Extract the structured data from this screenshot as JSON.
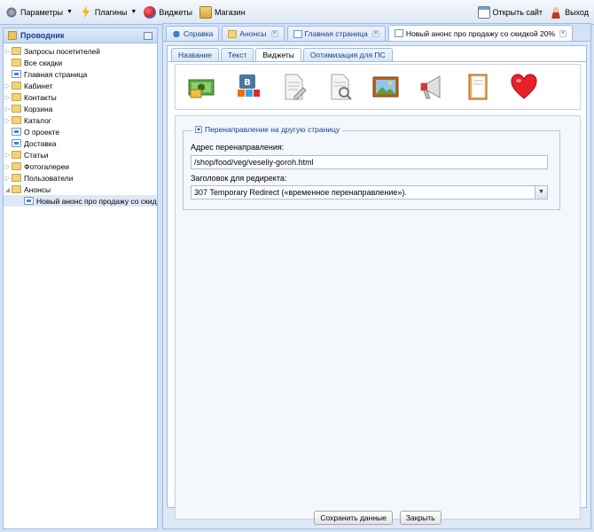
{
  "toolbar": {
    "params": "Параметры",
    "plugins": "Плагины",
    "widgets": "Виджеты",
    "shop": "Магазин",
    "open_site": "Открыть сайт",
    "logout": "Выход"
  },
  "explorer": {
    "title": "Проводник",
    "items": [
      {
        "label": "Запросы посетителей",
        "type": "folder",
        "expandable": true
      },
      {
        "label": "Все скидки",
        "type": "folder",
        "expandable": false
      },
      {
        "label": "Главная страница",
        "type": "page",
        "expandable": false
      },
      {
        "label": "Кабинет",
        "type": "folder",
        "expandable": true
      },
      {
        "label": "Контакты",
        "type": "folder",
        "expandable": true
      },
      {
        "label": "Корзина",
        "type": "folder",
        "expandable": true
      },
      {
        "label": "Каталог",
        "type": "folder",
        "expandable": true
      },
      {
        "label": "О проекте",
        "type": "page",
        "expandable": false
      },
      {
        "label": "Доставка",
        "type": "page",
        "expandable": false
      },
      {
        "label": "Статьи",
        "type": "folder",
        "expandable": true
      },
      {
        "label": "Фотогалереи",
        "type": "folder",
        "expandable": true
      },
      {
        "label": "Пользователи",
        "type": "folder",
        "expandable": true
      },
      {
        "label": "Анонсы",
        "type": "folder",
        "expandable": true,
        "expanded": true
      },
      {
        "label": "Новый анонс про продажу со скидк...",
        "type": "page",
        "expandable": false,
        "child": true,
        "selected": true
      }
    ]
  },
  "tabs": [
    {
      "label": "Справка",
      "closable": false
    },
    {
      "label": "Анонсы",
      "closable": true
    },
    {
      "label": "Главная страница",
      "closable": true
    },
    {
      "label": "Новый анонс про продажу со скидкой 20%",
      "closable": true,
      "active": true
    }
  ],
  "subtabs": [
    "Название",
    "Текст",
    "Виджеты",
    "Оптимизация для ПС"
  ],
  "active_subtab": "Виджеты",
  "widget_icons": [
    "money-icon",
    "social-icon",
    "document-edit-icon",
    "document-search-icon",
    "picture-icon",
    "megaphone-icon",
    "book-icon",
    "heart-icon"
  ],
  "redirect": {
    "legend": "Перенаправление на другую страницу",
    "address_label": "Адрес перенаправления:",
    "address_value": "/shop/food/veg/veseliy-goroh.html",
    "header_label": "Заголовок для редиректа:",
    "header_value": "307 Temporary Redirect («временное перенаправление»)."
  },
  "buttons": {
    "save": "Сохранить данные",
    "close": "Закрыть"
  },
  "colors": {
    "accent": "#15428b",
    "border": "#99bbe8",
    "heart": "#e8202a"
  }
}
